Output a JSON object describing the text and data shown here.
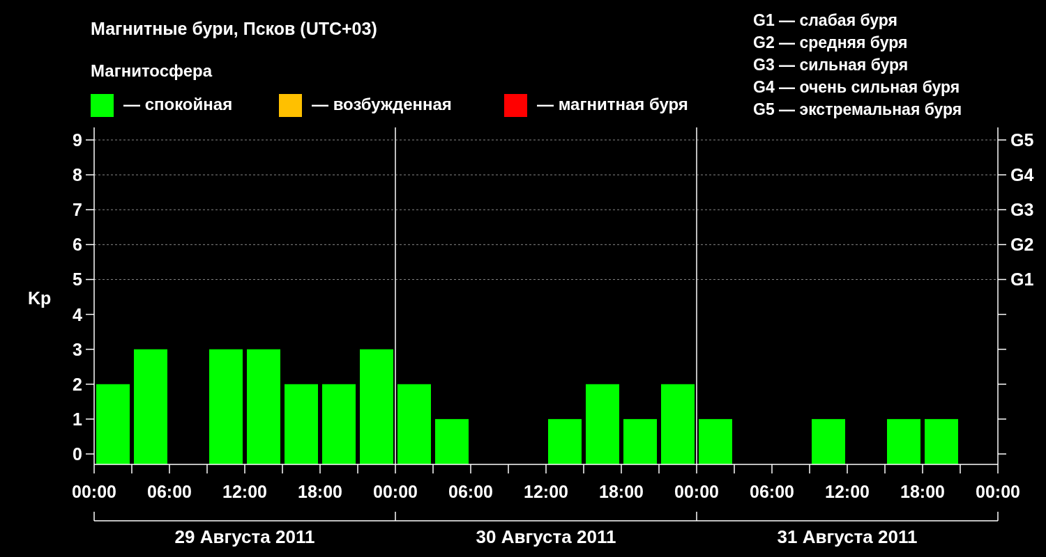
{
  "title": "Магнитные бури, Псков (UTC+03)",
  "legend": {
    "title": "Магнитосфера",
    "items": [
      {
        "label": "— спокойная",
        "color": "#00ff00"
      },
      {
        "label": "— возбужденная",
        "color": "#ffc000"
      },
      {
        "label": "— магнитная буря",
        "color": "#ff0000"
      }
    ]
  },
  "storm_scale": [
    "G1 — слабая буря",
    "G2 — средняя буря",
    "G3 — сильная буря",
    "G4 — очень сильная буря",
    "G5 — экстремальная буря"
  ],
  "storm_axis": [
    "G5",
    "G4",
    "G3",
    "G2",
    "G1"
  ],
  "time_labels": [
    "00:00",
    "06:00",
    "12:00",
    "18:00",
    "00:00",
    "06:00",
    "12:00",
    "18:00",
    "00:00",
    "06:00",
    "12:00",
    "18:00",
    "00:00"
  ],
  "days": [
    "29 Августа 2011",
    "30 Августа 2011",
    "31 Августа 2011"
  ],
  "chart_data": {
    "type": "bar",
    "ylabel": "Kp",
    "ylim": [
      0,
      9
    ],
    "yticks": [
      0,
      1,
      2,
      3,
      4,
      5,
      6,
      7,
      8,
      9
    ],
    "grid": true,
    "series": [
      {
        "color": "#00ff00",
        "values": [
          2,
          3,
          0,
          3,
          3,
          2,
          2,
          3,
          2,
          1,
          0,
          0,
          1,
          2,
          1,
          2,
          1,
          0,
          0,
          1,
          0,
          1,
          1,
          0
        ]
      }
    ]
  }
}
